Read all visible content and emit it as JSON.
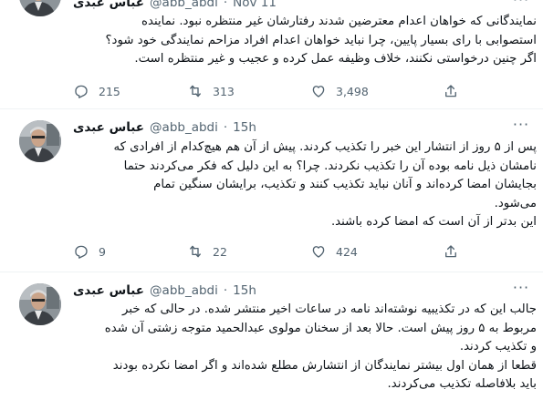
{
  "tweets": [
    {
      "name": "عباس عبدی",
      "handle": "@abb_abdi",
      "dot": "·",
      "time": "Nov 11",
      "more": "···",
      "text": "نمایندگانی که خواهان اعدام معترضین شدند رفتارشان غیر منتظره نبود. نماینده\nاستصوابی با رای بسیار پایین، چرا نباید خواهان اعدام افراد مزاحم نمایندگی خود شود؟\nاگر چنین درخواستی نکنند، خلاف وظیفه عمل کرده و عجیب و غیر منتظره است.",
      "replies": "215",
      "retweets": "313",
      "likes": "3,498"
    },
    {
      "name": "عباس عبدی",
      "handle": "@abb_abdi",
      "dot": "·",
      "time": "15h",
      "more": "···",
      "text": "پس از ۵ روز از انتشار این خبر را تکذیب کردند. پیش از آن هم هیچ‌کدام از افرادی که\nنامشان ذیل نامه بوده آن را تکذیب نکردند. چرا؟ به این دلیل که فکر می‌کردند حتما\nبجایشان امضا کرده‌اند و آنان نباید تکذیب کنند و تکذیب، برایشان سنگین تمام\nمی‌شود.\nاین بدتر از آن است که امضا کرده باشند.",
      "replies": "9",
      "retweets": "22",
      "likes": "424"
    },
    {
      "name": "عباس عبدی",
      "handle": "@abb_abdi",
      "dot": "·",
      "time": "15h",
      "more": "···",
      "text": "جالب این که در تکذیبیه نوشته‌اند نامه در ساعات اخیر منتشر شده. در حالی که خبر\nمربوط به ۵ روز پیش است. حالا بعد از سخنان مولوی عبدالحمید متوجه زشتی آن شده\nو تکذیب کردند.\nقطعا از همان اول بیشتر نمایندگان از انتشارش مطلع شده‌اند و اگر امضا نکرده بودند\nباید بلافاصله تکذیب می‌کردند."
    }
  ],
  "icons": [
    "reply-icon",
    "retweet-icon",
    "like-icon",
    "share-icon"
  ],
  "colors": {
    "text": "#0f1419",
    "secondary": "#536471",
    "divider": "#eff3f4"
  }
}
